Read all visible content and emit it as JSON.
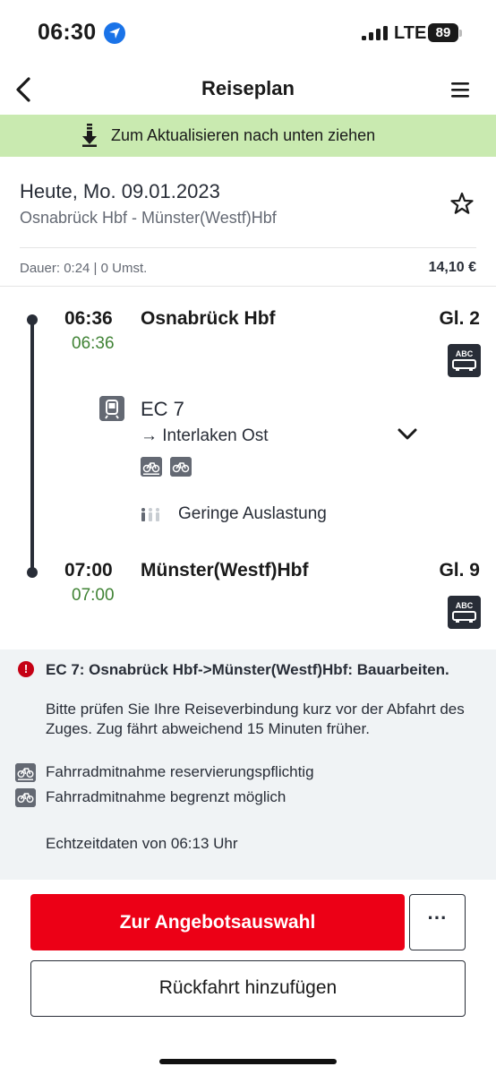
{
  "status_bar": {
    "time": "06:30",
    "network": "LTE",
    "battery": "89"
  },
  "header": {
    "title": "Reiseplan"
  },
  "refresh_banner": {
    "text": "Zum Aktualisieren nach unten ziehen"
  },
  "trip": {
    "date": "Heute, Mo. 09.01.2023",
    "route": "Osnabrück Hbf - Münster(Westf)Hbf",
    "duration": "Dauer: 0:24 | 0 Umst.",
    "price": "14,10 €"
  },
  "departure": {
    "time_scheduled": "06:36",
    "time_realtime": "06:36",
    "station": "Osnabrück Hbf",
    "platform": "Gl. 2",
    "wagon_label": "ABC"
  },
  "train": {
    "name": "EC 7",
    "direction": "→ Interlaken Ost",
    "occupancy": "Geringe Auslastung"
  },
  "arrival": {
    "time_scheduled": "07:00",
    "time_realtime": "07:00",
    "station": "Münster(Westf)Hbf",
    "platform": "Gl. 9",
    "wagon_label": "ABC"
  },
  "notices": {
    "warning_title": "EC 7: Osnabrück Hbf->Münster(Westf)Hbf: Bauarbeiten.",
    "warning_body": "Bitte prüfen Sie Ihre Reiseverbindung kurz vor der Abfahrt des Zuges. Zug fährt abweichend 15 Minuten früher.",
    "bike_reservation": "Fahrradmitnahme reservierungspflichtig",
    "bike_limited": "Fahrradmitnahme begrenzt möglich",
    "realtime_info": "Echtzeitdaten von 06:13 Uhr"
  },
  "actions": {
    "primary": "Zur Angebotsauswahl",
    "more": "···",
    "secondary": "Rückfahrt hinzufügen"
  },
  "colors": {
    "brand_red": "#ec0016",
    "realtime_green": "#408335",
    "banner_green": "#c9eab0",
    "dark": "#282d37"
  }
}
